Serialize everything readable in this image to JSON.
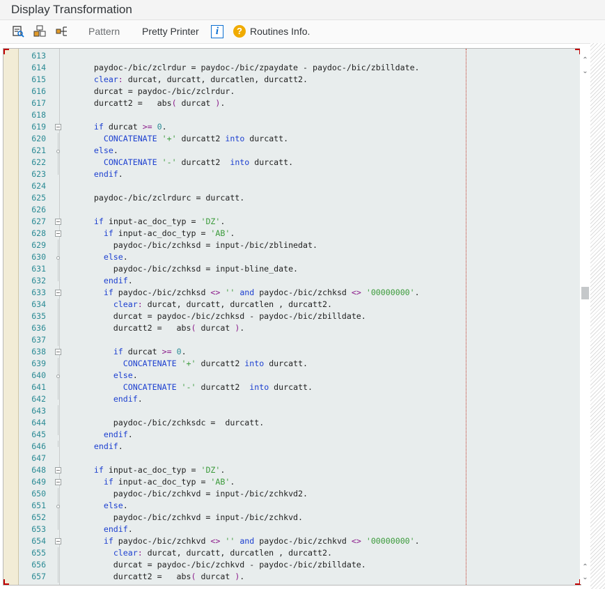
{
  "window": {
    "title": "Display Transformation"
  },
  "toolbar": {
    "pattern_label": "Pattern",
    "pretty_printer_label": "Pretty Printer",
    "info_label": "i",
    "help_label": "?",
    "routines_info_label": "Routines Info."
  },
  "editor": {
    "lines": [
      {
        "n": "613",
        "t": ""
      },
      {
        "n": "614",
        "t": "      paydoc-/bic/zclrdur = paydoc-/bic/zpaydate - paydoc-/bic/zbilldate."
      },
      {
        "n": "615",
        "t": "      clear: durcat, durcatt, durcatlen, durcatt2."
      },
      {
        "n": "616",
        "t": "      durcat = paydoc-/bic/zclrdur."
      },
      {
        "n": "617",
        "t": "      durcatt2 =   abs( durcat )."
      },
      {
        "n": "618",
        "t": ""
      },
      {
        "n": "619",
        "t": "      if durcat >= 0."
      },
      {
        "n": "620",
        "t": "        CONCATENATE '+' durcatt2 into durcatt."
      },
      {
        "n": "621",
        "t": "      else."
      },
      {
        "n": "622",
        "t": "        CONCATENATE '-' durcatt2  into durcatt."
      },
      {
        "n": "623",
        "t": "      endif."
      },
      {
        "n": "624",
        "t": ""
      },
      {
        "n": "625",
        "t": "      paydoc-/bic/zclrdurc = durcatt."
      },
      {
        "n": "626",
        "t": ""
      },
      {
        "n": "627",
        "t": "      if input-ac_doc_typ = 'DZ'."
      },
      {
        "n": "628",
        "t": "        if input-ac_doc_typ = 'AB'."
      },
      {
        "n": "629",
        "t": "          paydoc-/bic/zchksd = input-/bic/zblinedat."
      },
      {
        "n": "630",
        "t": "        else."
      },
      {
        "n": "631",
        "t": "          paydoc-/bic/zchksd = input-bline_date."
      },
      {
        "n": "632",
        "t": "        endif."
      },
      {
        "n": "633",
        "t": "        if paydoc-/bic/zchksd <> '' and paydoc-/bic/zchksd <> '00000000'."
      },
      {
        "n": "634",
        "t": "          clear: durcat, durcatt, durcatlen , durcatt2."
      },
      {
        "n": "635",
        "t": "          durcat = paydoc-/bic/zchksd - paydoc-/bic/zbilldate."
      },
      {
        "n": "636",
        "t": "          durcatt2 =   abs( durcat )."
      },
      {
        "n": "637",
        "t": ""
      },
      {
        "n": "638",
        "t": "          if durcat >= 0."
      },
      {
        "n": "639",
        "t": "            CONCATENATE '+' durcatt2 into durcatt."
      },
      {
        "n": "640",
        "t": "          else."
      },
      {
        "n": "641",
        "t": "            CONCATENATE '-' durcatt2  into durcatt."
      },
      {
        "n": "642",
        "t": "          endif."
      },
      {
        "n": "643",
        "t": ""
      },
      {
        "n": "644",
        "t": "          paydoc-/bic/zchksdc =  durcatt."
      },
      {
        "n": "645",
        "t": "        endif."
      },
      {
        "n": "646",
        "t": "      endif."
      },
      {
        "n": "647",
        "t": ""
      },
      {
        "n": "648",
        "t": "      if input-ac_doc_typ = 'DZ'."
      },
      {
        "n": "649",
        "t": "        if input-ac_doc_typ = 'AB'."
      },
      {
        "n": "650",
        "t": "          paydoc-/bic/zchkvd = input-/bic/zchkvd2."
      },
      {
        "n": "651",
        "t": "        else."
      },
      {
        "n": "652",
        "t": "          paydoc-/bic/zchkvd = input-/bic/zchkvd."
      },
      {
        "n": "653",
        "t": "        endif."
      },
      {
        "n": "654",
        "t": "        if paydoc-/bic/zchkvd <> '' and paydoc-/bic/zchkvd <> '00000000'."
      },
      {
        "n": "655",
        "t": "          clear: durcat, durcatt, durcatlen , durcatt2."
      },
      {
        "n": "656",
        "t": "          durcat = paydoc-/bic/zchkvd - paydoc-/bic/zbilldate."
      },
      {
        "n": "657",
        "t": "          durcatt2 =   abs( durcat )."
      }
    ]
  },
  "colors": {
    "keyword": "#1d40d0",
    "string": "#3a9a3a",
    "number": "#2a8a94",
    "operator": "#8b1c8b"
  }
}
